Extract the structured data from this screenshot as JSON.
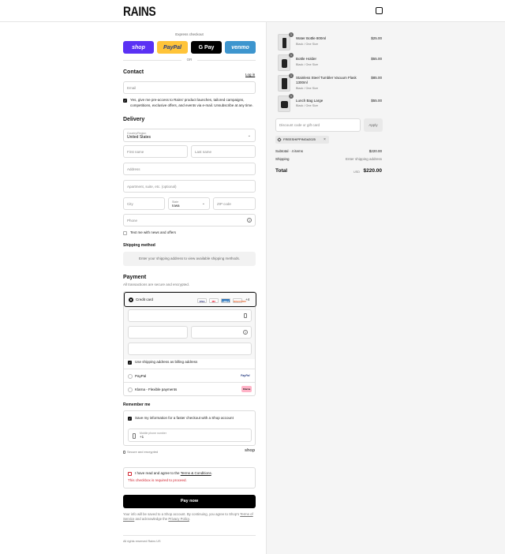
{
  "header": {
    "logo": "RAINS",
    "bag_icon": "shopping-bag-icon"
  },
  "express": {
    "title": "Express checkout",
    "buttons": [
      {
        "label": "shop",
        "bg": "#5a31f4",
        "fg": "#ffffff"
      },
      {
        "label": "PayPal",
        "bg": "#ffc439",
        "fg": "#253b80"
      },
      {
        "label": "G Pay",
        "bg": "#000000",
        "fg": "#ffffff"
      },
      {
        "label": "venmo",
        "bg": "#3d95ce",
        "fg": "#ffffff"
      }
    ],
    "or": "OR"
  },
  "contact": {
    "title": "Contact",
    "login": "Log in",
    "email_placeholder": "Email",
    "consent": "Yes, give me pre-access to Rains' product launches, tailored campaigns, competitions, exclusive offers, and events via e-mail. Unsubscribe at any time."
  },
  "delivery": {
    "title": "Delivery",
    "country_label": "Country/Region",
    "country": "United States",
    "first_name": "First name",
    "last_name": "Last name",
    "address": "Address",
    "apartment": "Apartment, suite, etc. (optional)",
    "city": "City",
    "state_label": "State",
    "state": "Iowa",
    "zip": "ZIP code",
    "phone": "Phone",
    "text_me": "Text me with news and offers"
  },
  "shipping": {
    "title": "Shipping method",
    "message": "Enter your shipping address to view available shipping methods."
  },
  "payment": {
    "title": "Payment",
    "subtitle": "All transactions are secure and encrypted.",
    "credit_card": "Credit card",
    "card_logos": [
      {
        "label": "VISA",
        "bg": "#ffffff",
        "fg": "#1a1f71"
      },
      {
        "label": "MC",
        "bg": "#ffffff",
        "fg": "#eb001b"
      },
      {
        "label": "AMEX",
        "bg": "#2e77bc",
        "fg": "#ffffff"
      },
      {
        "label": "DISCOVER",
        "bg": "#ffffff",
        "fg": "#e55c20"
      }
    ],
    "more_cards": "+4",
    "billing_same": "Use shipping address as billing address",
    "paypal": "PayPal",
    "paypal_badge": "PayPal",
    "klarna": "Klarna - Flexible payments",
    "klarna_badge": "Klarna"
  },
  "remember": {
    "title": "Remember me",
    "save_info": "Save my information for a faster checkout with a Shop account",
    "mobile_label": "Mobile phone number",
    "mobile_prefix": "+1",
    "secure": "Secure and encrypted",
    "shop": "shop"
  },
  "terms": {
    "prefix": "I have read and agree to the ",
    "link": "Terms & Conditions",
    "suffix": ".",
    "error": "This checkbox is required to proceed."
  },
  "pay_now": "Pay now",
  "disclaimer": {
    "part1": "Your info will be saved to a Shop account. By continuing, you agree to Shop's ",
    "tos": "Terms of Service",
    "part2": " and acknowledge the ",
    "privacy": "Privacy Policy",
    "part3": "."
  },
  "footer": "All rights reserved Rains US",
  "order": {
    "items": [
      {
        "qty": "1",
        "name": "Water Bottle 800ml",
        "variant": "Black / One Size",
        "price": "$25.00"
      },
      {
        "qty": "1",
        "name": "Bottle Holder",
        "variant": "Black / One Size",
        "price": "$55.00"
      },
      {
        "qty": "1",
        "name": "Stainless Steel Tumbler Vacuum Flask 1300ml",
        "variant": "Black / One Size",
        "price": "$85.00"
      },
      {
        "qty": "1",
        "name": "Lunch Bag Large",
        "variant": "Black / One Size",
        "price": "$55.00"
      }
    ],
    "discount_placeholder": "Discount code or gift card",
    "apply": "Apply",
    "code": "FREESHIPPING#2025",
    "subtotal_label": "Subtotal · 4 items",
    "subtotal": "$220.00",
    "shipping_label": "Shipping",
    "shipping_value": "Enter shipping address",
    "total_label": "Total",
    "currency": "USD",
    "total": "$220.00"
  }
}
